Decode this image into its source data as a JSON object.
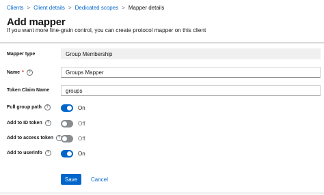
{
  "breadcrumb": {
    "items": [
      "Clients",
      "Client details",
      "Dedicated scopes",
      "Mapper details"
    ],
    "separator": ">"
  },
  "page": {
    "title": "Add mapper",
    "subtitle": "If you want more fine-grain control, you can create protocol mapper on this client"
  },
  "form": {
    "mapper_type": {
      "label": "Mapper type",
      "value": "Group Membership"
    },
    "name": {
      "label": "Name",
      "required_marker": "*",
      "value": "Groups Mapper"
    },
    "token_claim_name": {
      "label": "Token Claim Name",
      "value": "groups"
    },
    "full_group_path": {
      "label": "Full group path",
      "state": "On",
      "enabled": true
    },
    "add_to_id_token": {
      "label": "Add to ID token",
      "state": "Off",
      "enabled": false
    },
    "add_to_access_token": {
      "label": "Add to access token",
      "state": "Off",
      "enabled": false
    },
    "add_to_userinfo": {
      "label": "Add to userinfo",
      "state": "On",
      "enabled": true
    },
    "help_icon": "?"
  },
  "actions": {
    "save_label": "Save",
    "cancel_label": "Cancel"
  },
  "colors": {
    "accent": "#0066cc",
    "toggle_off": "#8a8d90",
    "required": "#c9190b"
  },
  "icons": {
    "help": "question-circle-icon",
    "separator": "chevron-right-icon"
  }
}
